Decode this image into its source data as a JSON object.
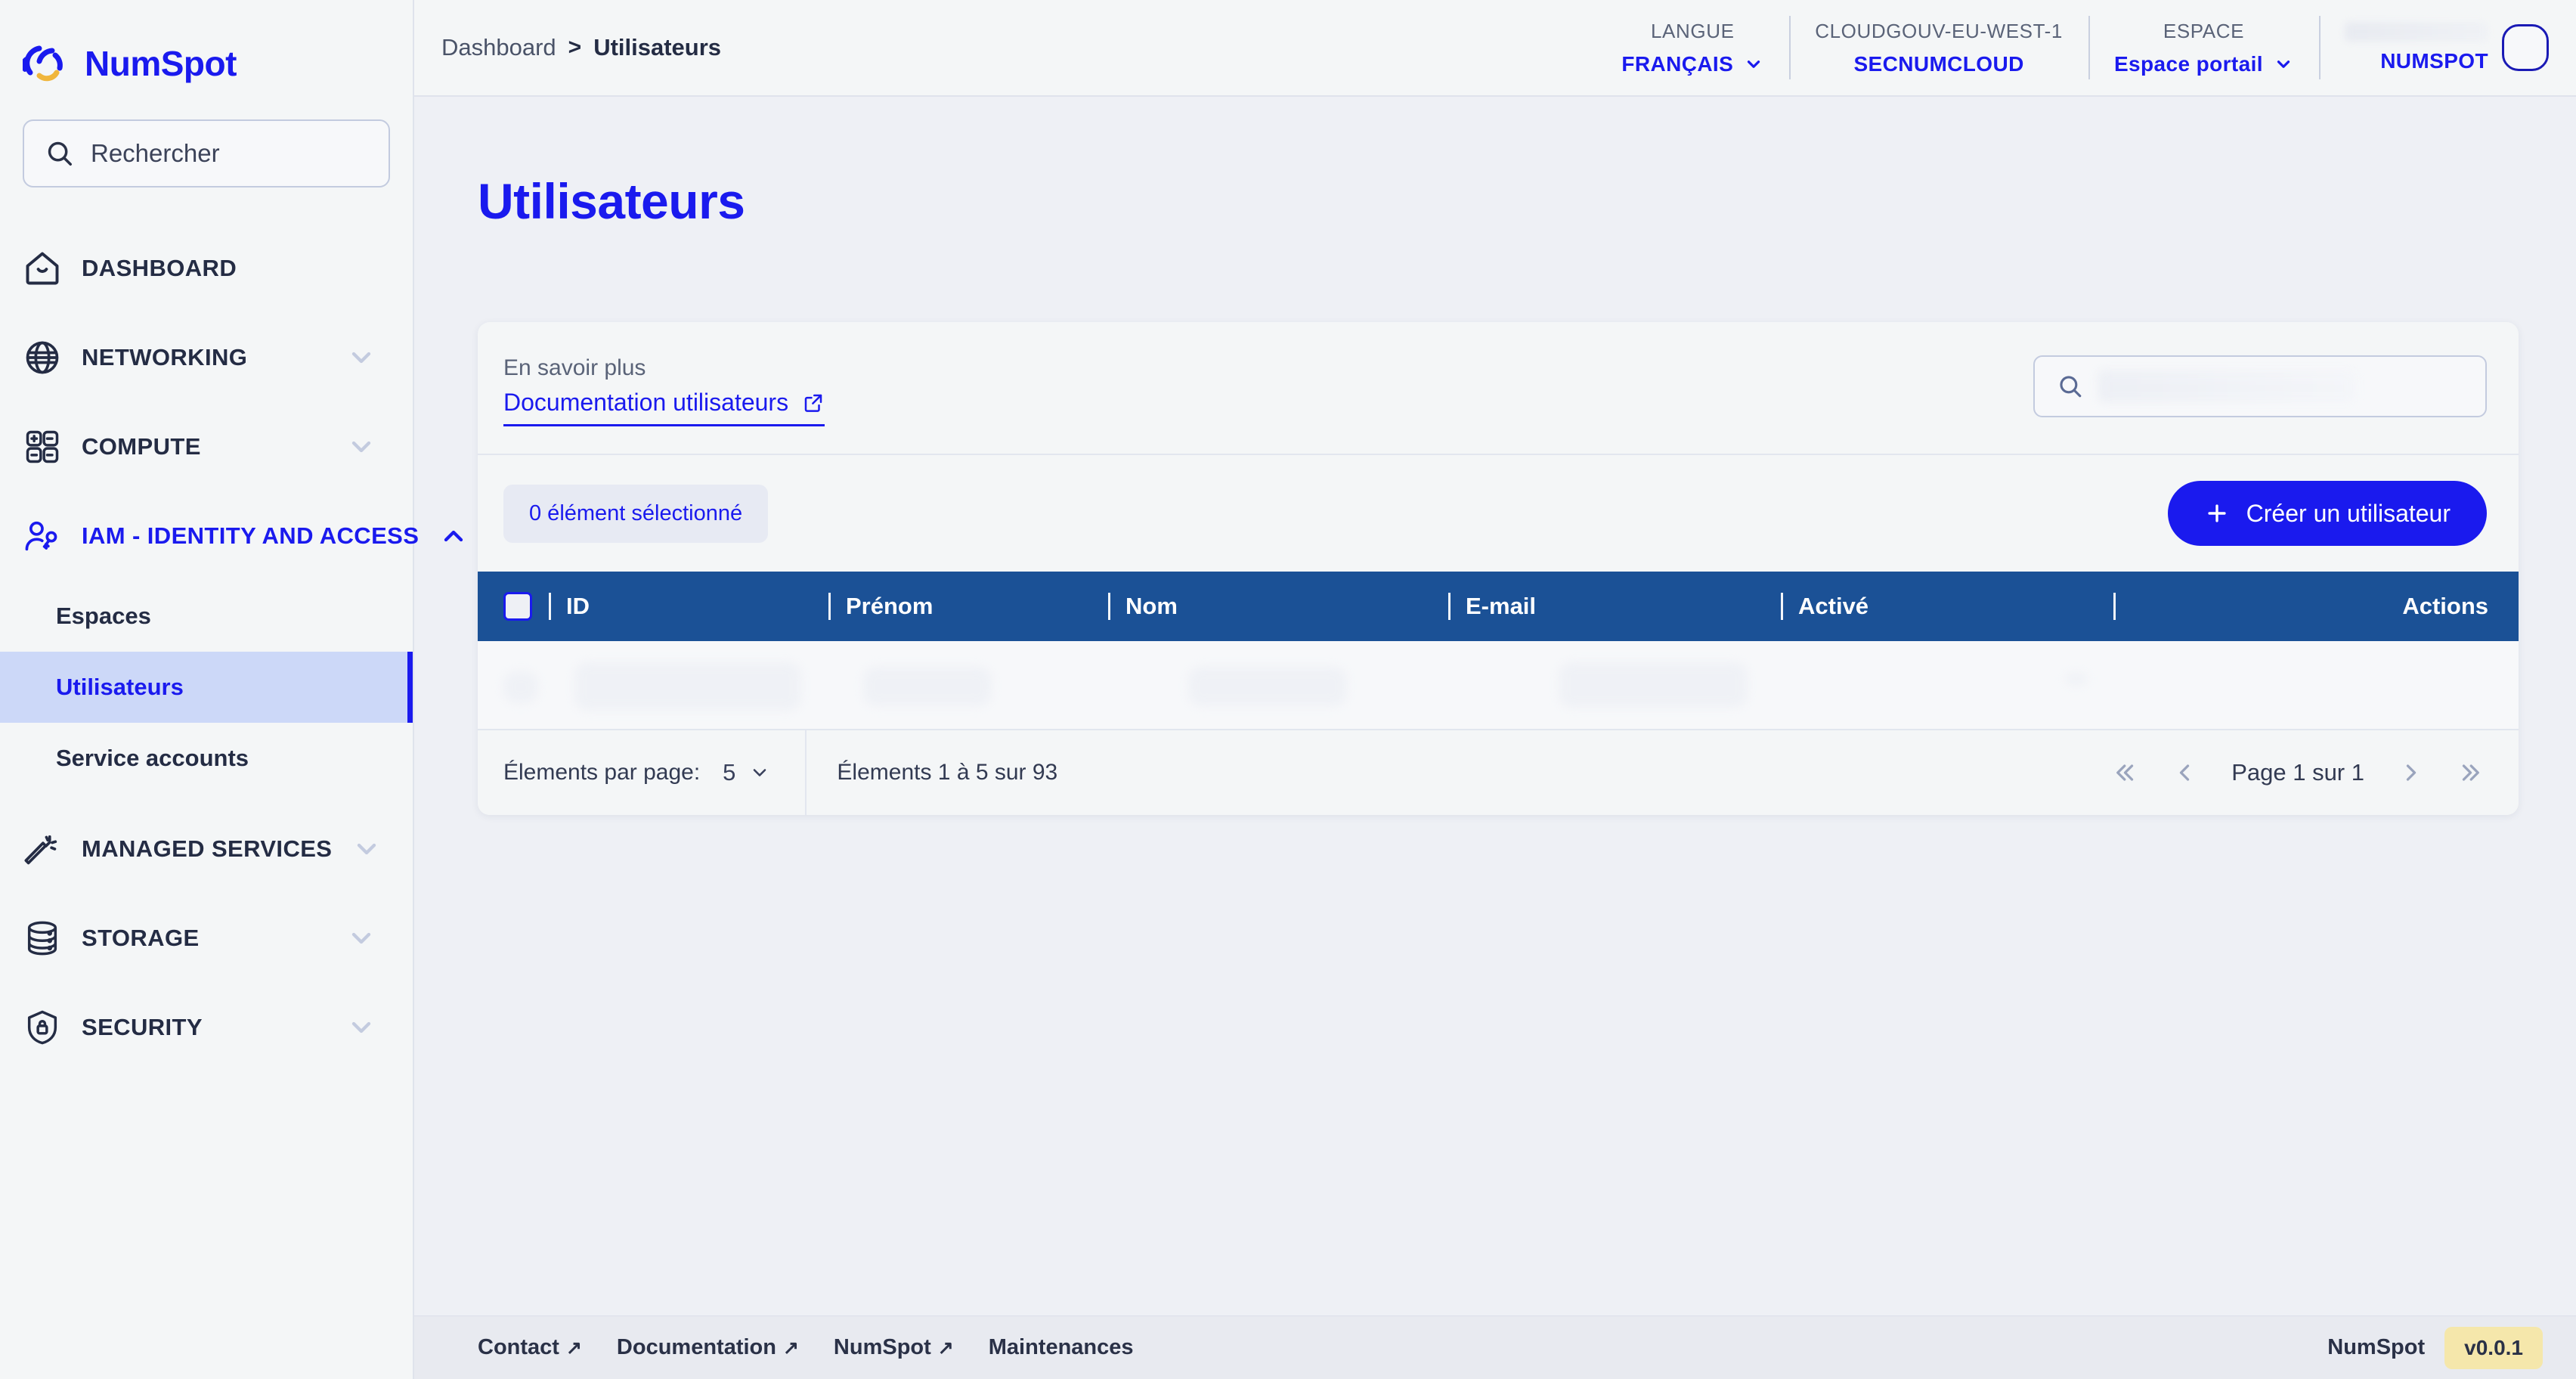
{
  "brand": {
    "name": "NumSpot",
    "logo_icon": "numspot-logo-icon"
  },
  "sidebar": {
    "search": {
      "placeholder": "Rechercher",
      "value": "",
      "icon": "search-icon"
    },
    "groups": [
      {
        "label": "DASHBOARD",
        "icon": "home-icon",
        "expandable": false,
        "active": false
      },
      {
        "label": "NETWORKING",
        "icon": "globe-icon",
        "expandable": true,
        "expanded": false,
        "active": false
      },
      {
        "label": "COMPUTE",
        "icon": "grid-icon",
        "expandable": true,
        "expanded": false,
        "active": false
      },
      {
        "label": "IAM - IDENTITY AND ACCESS",
        "icon": "user-key-icon",
        "expandable": true,
        "expanded": true,
        "active": true
      },
      {
        "label": "MANAGED SERVICES",
        "icon": "magic-wand-icon",
        "expandable": true,
        "expanded": false,
        "active": false
      },
      {
        "label": "STORAGE",
        "icon": "database-icon",
        "expandable": true,
        "expanded": false,
        "active": false
      },
      {
        "label": "SECURITY",
        "icon": "shield-lock-icon",
        "expandable": true,
        "expanded": false,
        "active": false
      }
    ],
    "iam_children": [
      {
        "label": "Espaces",
        "selected": false
      },
      {
        "label": "Utilisateurs",
        "selected": true
      },
      {
        "label": "Service accounts",
        "selected": false
      }
    ]
  },
  "topbar": {
    "breadcrumb": {
      "parent": "Dashboard",
      "separator": ">",
      "current": "Utilisateurs"
    },
    "language": {
      "label": "LANGUE",
      "value": "FRANÇAIS",
      "chevron": "chevron-down-icon"
    },
    "region": {
      "label": "CLOUDGOUV-EU-WEST-1",
      "value": "SECNUMCLOUD"
    },
    "space": {
      "label": "ESPACE",
      "value": "Espace portail",
      "chevron": "chevron-down-icon"
    },
    "account": {
      "org": "NUMSPOT",
      "avatar": "avatar"
    }
  },
  "page": {
    "title": "Utilisateurs"
  },
  "card": {
    "learn_more_label": "En savoir plus",
    "doc_link_label": "Documentation utilisateurs",
    "doc_link_icon": "external-link-icon",
    "search": {
      "placeholder": "",
      "value": "",
      "icon": "search-icon"
    },
    "selection_chip": "0 élément sélectionné",
    "create_button": {
      "label": "Créer un utilisateur",
      "icon": "plus-icon"
    }
  },
  "table": {
    "select_all": "select-all-checkbox",
    "columns": [
      "ID",
      "Prénom",
      "Nom",
      "E-mail",
      "Activé",
      "Actions"
    ],
    "rows": []
  },
  "pagination": {
    "per_page_label": "Élements par page:",
    "per_page_value": "5",
    "per_page_chevron": "chevron-down-icon",
    "range_text": "Élements 1 à 5 sur 93",
    "first_icon": "chevrons-left-icon",
    "prev_icon": "chevron-left-icon",
    "page_text": "Page 1 sur 1",
    "next_icon": "chevron-right-icon",
    "last_icon": "chevrons-right-icon"
  },
  "footer": {
    "links": [
      {
        "label": "Contact",
        "external": "↗"
      },
      {
        "label": "Documentation",
        "external": "↗"
      },
      {
        "label": "NumSpot",
        "external": "↗"
      },
      {
        "label": "Maintenances",
        "external": ""
      }
    ],
    "brand": "NumSpot",
    "version": "v0.0.1"
  },
  "colors": {
    "brand_blue": "#1a1aee",
    "table_header_blue": "#1b5196",
    "sidebar_bg": "#f4f6f7",
    "content_bg": "#eef0f5",
    "version_badge": "#f5e7ab",
    "logo_accent": "#f0b63c"
  }
}
